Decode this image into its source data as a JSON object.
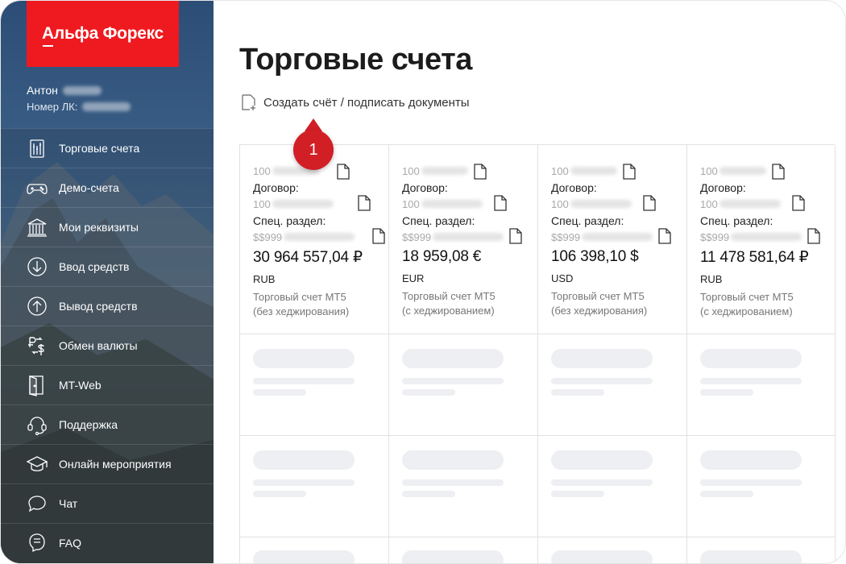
{
  "brand": {
    "logo_text": "Альфа Форекс",
    "color": "#EF1A1F"
  },
  "user": {
    "name": "Антон",
    "lk_label": "Номер ЛК:"
  },
  "sidebar": {
    "items": [
      {
        "label": "Торговые счета",
        "icon": "trading-accounts-icon"
      },
      {
        "label": "Демо-счета",
        "icon": "gamepad-icon"
      },
      {
        "label": "Мои реквизиты",
        "icon": "bank-icon"
      },
      {
        "label": "Ввод средств",
        "icon": "deposit-icon"
      },
      {
        "label": "Вывод средств",
        "icon": "withdraw-icon"
      },
      {
        "label": "Обмен валюты",
        "icon": "currency-exchange-icon"
      },
      {
        "label": "MT-Web",
        "icon": "mt-web-icon"
      },
      {
        "label": "Поддержка",
        "icon": "headset-icon"
      },
      {
        "label": "Онлайн мероприятия",
        "icon": "graduation-cap-icon"
      },
      {
        "label": "Чат",
        "icon": "chat-icon"
      },
      {
        "label": "FAQ",
        "icon": "faq-icon"
      }
    ]
  },
  "main": {
    "title": "Торговые счета",
    "create_link": "Создать счёт / подписать документы",
    "callout_number": "1",
    "accounts": [
      {
        "account_prefix": "100",
        "contract_label": "Договор:",
        "contract_prefix": "100",
        "special_label": "Спец. раздел:",
        "special_prefix": "$$999",
        "amount": "30 964 557,04 ₽",
        "currency": "RUB",
        "desc_line1": "Торговый счет МТ5",
        "desc_line2": "(без хеджирования)"
      },
      {
        "account_prefix": "100",
        "contract_label": "Договор:",
        "contract_prefix": "100",
        "special_label": "Спец. раздел:",
        "special_prefix": "$$999",
        "amount": "18 959,08 €",
        "currency": "EUR",
        "desc_line1": "Торговый счет МТ5",
        "desc_line2": "(с хеджированием)"
      },
      {
        "account_prefix": "100",
        "contract_label": "Договор:",
        "contract_prefix": "100",
        "special_label": "Спец. раздел:",
        "special_prefix": "$$999",
        "amount": "106 398,10 $",
        "currency": "USD",
        "desc_line1": "Торговый счет МТ5",
        "desc_line2": "(без хеджирования)"
      },
      {
        "account_prefix": "100",
        "contract_label": "Договор:",
        "contract_prefix": "100",
        "special_label": "Спец. раздел:",
        "special_prefix": "$$999",
        "amount": "11 478 581,64 ₽",
        "currency": "RUB",
        "desc_line1": "Торговый счет МТ5",
        "desc_line2": "(с хеджированием)"
      }
    ]
  }
}
